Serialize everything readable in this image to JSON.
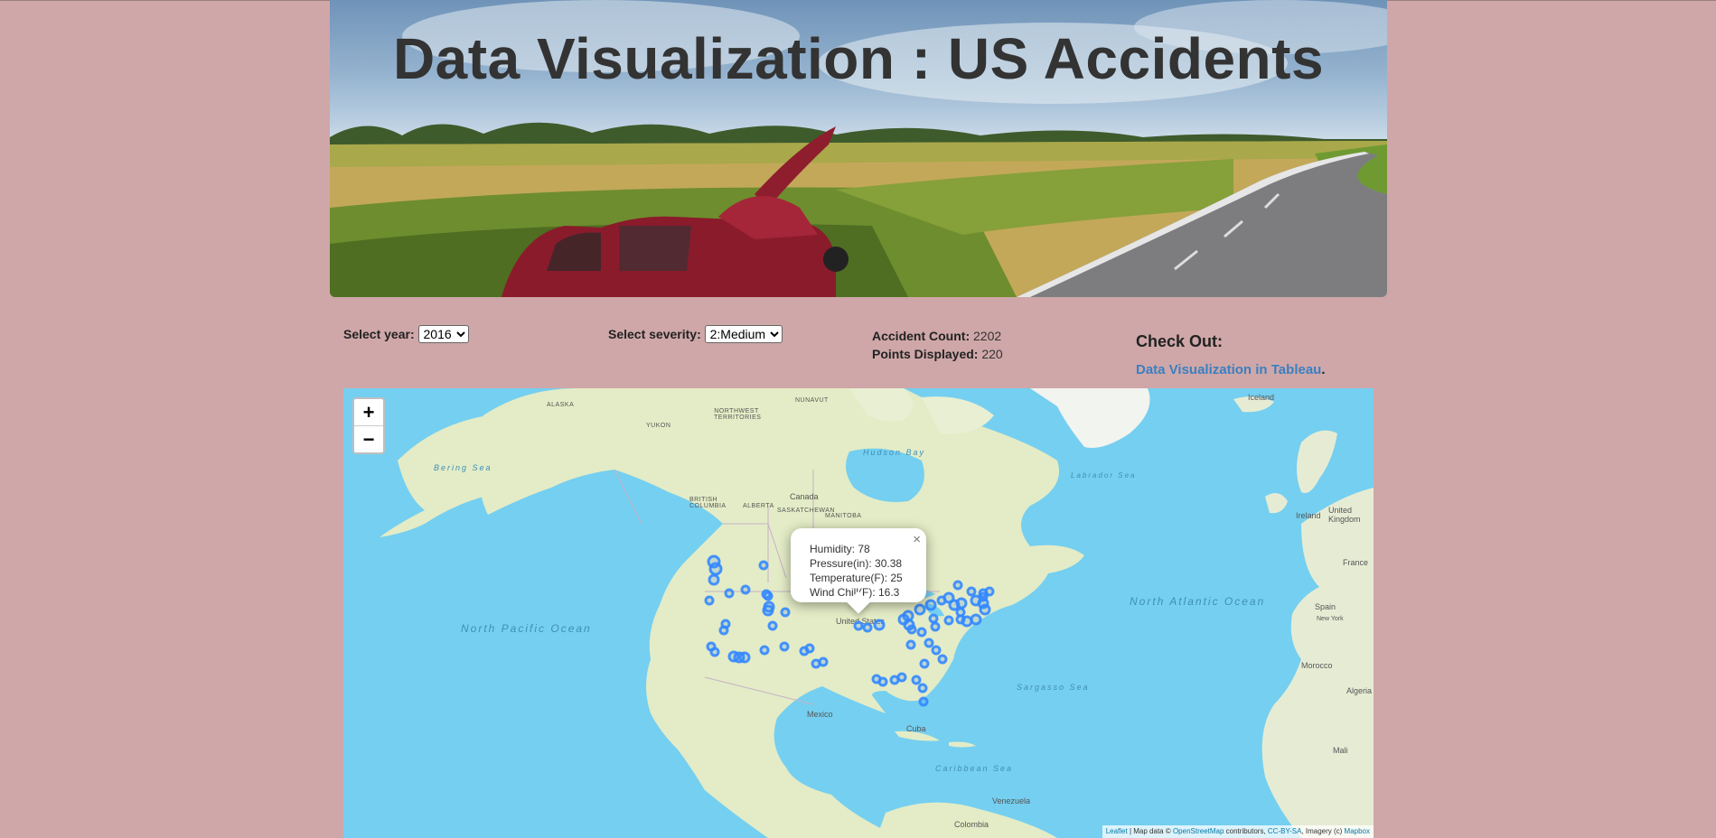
{
  "header": {
    "title": "Data Visualization : US Accidents"
  },
  "controls": {
    "year_label": "Select year:",
    "year_value": "2016",
    "year_options": [
      "2016"
    ],
    "severity_label": "Select severity:",
    "severity_value": "2:Medium",
    "severity_options": [
      "2:Medium"
    ]
  },
  "stats": {
    "count_label": "Accident Count:",
    "count_value": "2202",
    "displayed_label": "Points Displayed:",
    "displayed_value": "220"
  },
  "checkout": {
    "title": "Check Out:",
    "link_text": "Data Visualization in Tableau",
    "trailing": "."
  },
  "map": {
    "zoom_in": "+",
    "zoom_out": "−",
    "marker_color": "#3388ff",
    "popup": {
      "close": "×",
      "humidity": "Humidity: 78",
      "pressure": "Pressure(in): 30.38",
      "temperature": "Temperature(F): 25",
      "wind_chill": "Wind Chill(F): 16.3"
    },
    "labels": {
      "north_pacific_1": "North Pacific Ocean",
      "north_atlantic": "North Atlantic Ocean",
      "canada": "Canada",
      "united_states": "United States",
      "mexico": "Mexico",
      "iceland": "Iceland",
      "ireland": "Ireland",
      "united_kingdom": "United Kingdom",
      "france": "France",
      "spain": "Spain",
      "morocco": "Morocco",
      "algeria": "Algeria",
      "mali": "Mali",
      "cuba": "Cuba",
      "venezuela": "Venezuela",
      "colombia": "Colombia",
      "alaska": "ALASKA",
      "yukon": "YUKON",
      "nunavut": "NUNAVUT",
      "northwest_territories": "NORTHWEST TERRITORIES",
      "british_columbia": "BRITISH COLUMBIA",
      "alberta": "ALBERTA",
      "saskatchewan": "SASKATCHEWAN",
      "manitoba": "MANITOBA",
      "hudson_bay": "Hudson Bay",
      "bering_sea": "Bering Sea",
      "labrador_sea": "Labrador Sea",
      "sargasso_sea": "Sargasso Sea",
      "caribbean_sea": "Caribbean Sea",
      "new_york": "New York"
    },
    "attribution": {
      "leaflet": "Leaflet",
      "text1": " | Map data © ",
      "osm": "OpenStreetMap",
      "text2": " contributors, ",
      "ccbysa": "CC-BY-SA",
      "text3": ", Imagery (c) ",
      "mapbox": "Mapbox"
    }
  }
}
